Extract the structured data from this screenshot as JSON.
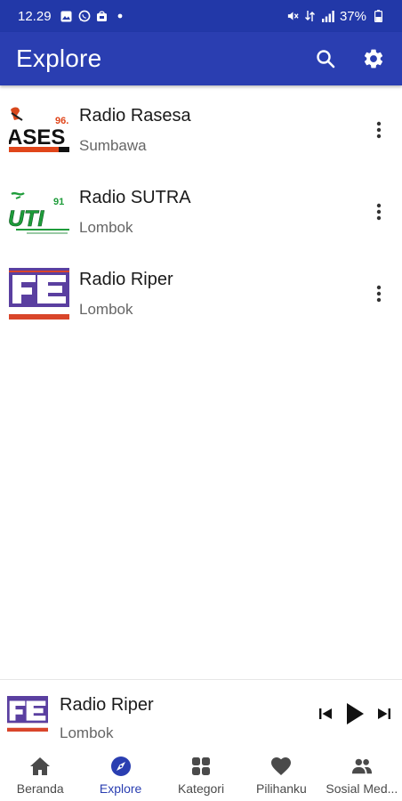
{
  "status_bar": {
    "time": "12.29",
    "battery": "37%",
    "icons_left": [
      "image-icon",
      "whatsapp-icon",
      "store-icon",
      "dot-icon"
    ],
    "icons_right": [
      "mute-icon",
      "data-icon",
      "signal-icon",
      "battery-icon"
    ]
  },
  "app_bar": {
    "title": "Explore",
    "actions": [
      "search-icon",
      "settings-icon"
    ],
    "color": "#2a3eb1"
  },
  "stations": [
    {
      "name": "Radio Rasesa",
      "region": "Sumbawa",
      "logo": "rasesa-logo"
    },
    {
      "name": "Radio SUTRA",
      "region": "Lombok",
      "logo": "sutra-logo"
    },
    {
      "name": "Radio Riper",
      "region": "Lombok",
      "logo": "riper-logo"
    }
  ],
  "mini_player": {
    "name": "Radio Riper",
    "region": "Lombok",
    "controls": [
      "previous-icon",
      "play-icon",
      "next-icon"
    ]
  },
  "bottom_nav": {
    "items": [
      {
        "label": "Beranda",
        "icon": "home-icon",
        "active": false
      },
      {
        "label": "Explore",
        "icon": "compass-icon",
        "active": true
      },
      {
        "label": "Kategori",
        "icon": "grid-icon",
        "active": false
      },
      {
        "label": "Pilihanku",
        "icon": "heart-icon",
        "active": false
      },
      {
        "label": "Sosial Med...",
        "icon": "people-icon",
        "active": false
      }
    ],
    "active_color": "#2a3eb1"
  }
}
